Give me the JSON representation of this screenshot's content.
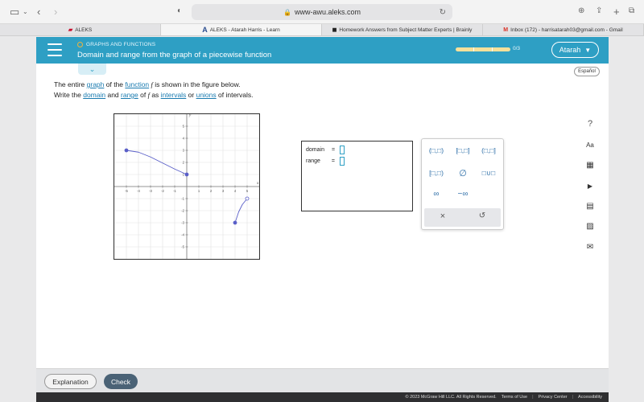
{
  "browser": {
    "url": "www-awu.aleks.com",
    "tabs": [
      {
        "label": "ALEKS",
        "active": false
      },
      {
        "label": "ALEKS - Atarah Harris - Learn",
        "active": true
      },
      {
        "label": "Homework Answers from Subject Matter Experts | Brainly",
        "active": false
      },
      {
        "label": "Inbox (172) - harrisatarah03@gmail.com - Gmail",
        "active": false
      }
    ]
  },
  "header": {
    "topic": "GRAPHS AND FUNCTIONS",
    "title": "Domain and range from the graph of a piecewise function",
    "progress_label": "0/3",
    "user": "Atarah",
    "accent": "#2e9fc4"
  },
  "espanol": "Español",
  "prompt": {
    "line1_a": "The entire ",
    "line1_graph": "graph",
    "line1_b": " of the ",
    "line1_function": "function",
    "line1_f": "f",
    "line1_c": " is shown in the figure below.",
    "line2_a": "Write the ",
    "line2_domain": "domain",
    "line2_b": " and ",
    "line2_range": "range",
    "line2_c": " of ",
    "line2_f": "f",
    "line2_d": " as ",
    "line2_intervals": "intervals",
    "line2_e": " or ",
    "line2_unions": "unions",
    "line2_f2": " of intervals."
  },
  "chart_data": {
    "type": "line",
    "xlabel": "x",
    "ylabel": "y",
    "xlim": [
      -6,
      6
    ],
    "ylim": [
      -6,
      6
    ],
    "x_ticks": [
      "-5",
      "-4",
      "-3",
      "-2",
      "-1",
      "1",
      "2",
      "3",
      "4",
      "5"
    ],
    "y_ticks": [
      "5",
      "4",
      "3",
      "2",
      "1",
      "-1",
      "-2",
      "-3",
      "-4",
      "-5"
    ],
    "grid": true,
    "series": [
      {
        "points": [
          [
            -5,
            3
          ],
          [
            -4,
            2.85
          ],
          [
            -3,
            2.45
          ],
          [
            -2,
            1.95
          ],
          [
            -1,
            1.45
          ],
          [
            0,
            1
          ]
        ],
        "start": "closed",
        "end": "closed"
      },
      {
        "points": [
          [
            4,
            -3
          ],
          [
            4.3,
            -2.1
          ],
          [
            4.6,
            -1.5
          ],
          [
            5,
            -1
          ]
        ],
        "start": "closed",
        "end": "open"
      }
    ],
    "color": "#5a5fc8"
  },
  "answer": {
    "domain_label": "domain",
    "range_label": "range",
    "equals": "="
  },
  "keypad": {
    "row1": [
      "(□,□)",
      "[□,□]",
      "(□,□]"
    ],
    "row2": [
      "[□,□)",
      "∅",
      "□∪□"
    ],
    "row3": [
      "∞",
      "−∞"
    ],
    "clear": "×",
    "undo": "↺"
  },
  "tools": [
    "?",
    "Aa",
    "▦",
    "▶",
    "▤",
    "▨",
    "✉"
  ],
  "footer": {
    "explanation": "Explanation",
    "check": "Check"
  },
  "legal": {
    "copyright": "© 2023 McGraw Hill LLC. All Rights Reserved.",
    "terms": "Terms of Use",
    "privacy": "Privacy Center",
    "accessibility": "Accessibility"
  }
}
